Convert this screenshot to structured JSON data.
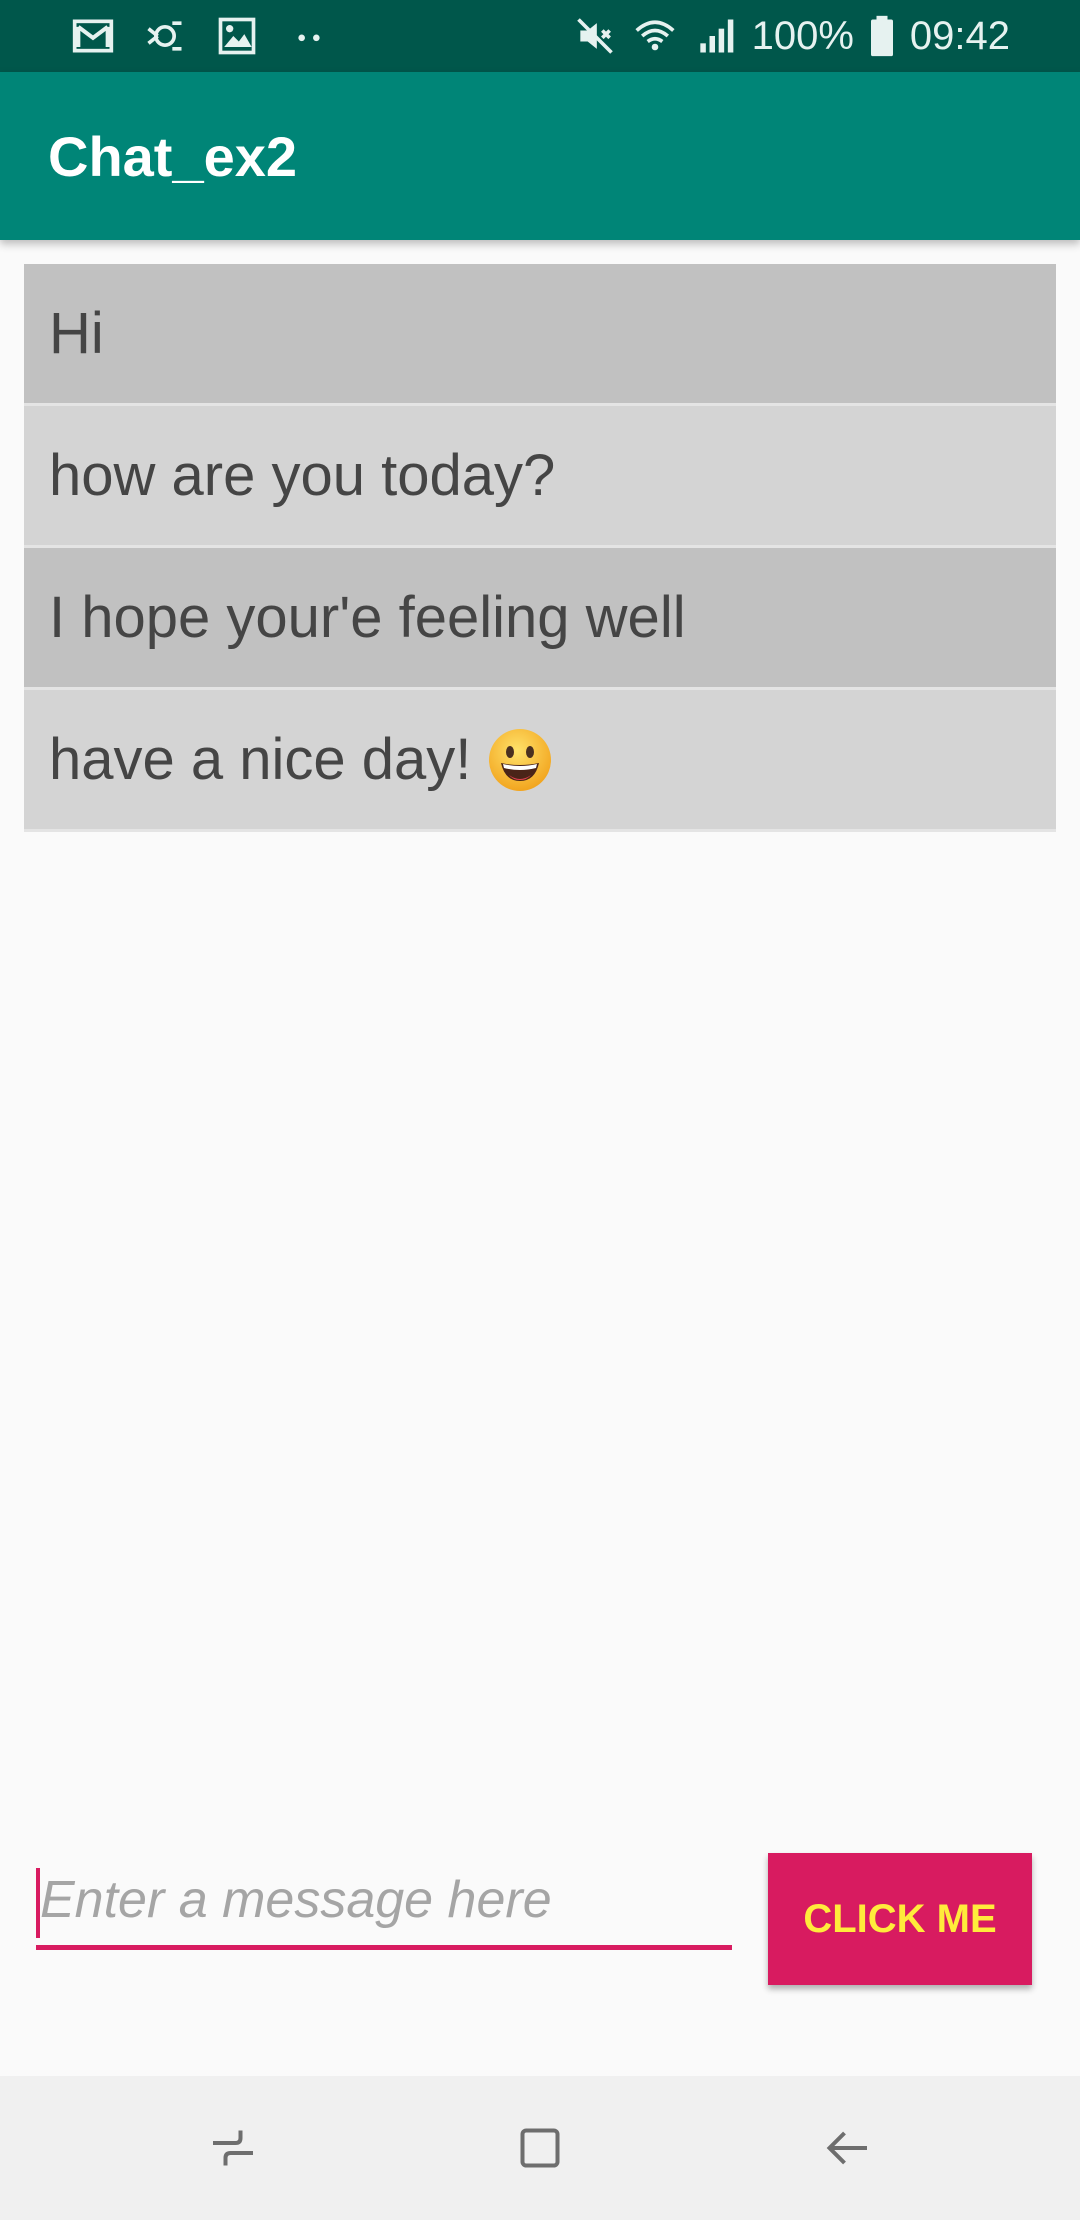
{
  "status_bar": {
    "left_icons": [
      "gmail-icon",
      "sync-icon",
      "image-icon",
      "more-dots-icon"
    ],
    "right_icons": [
      "mute-icon",
      "wifi-icon",
      "signal-icon",
      "battery-icon"
    ],
    "battery": "100%",
    "time": "09:42"
  },
  "app_bar": {
    "title": "Chat_ex2"
  },
  "messages": [
    {
      "text": "Hi",
      "shade": "dark",
      "emoji": false
    },
    {
      "text": "how are you today?",
      "shade": "light",
      "emoji": false
    },
    {
      "text": "I hope your'e feeling well",
      "shade": "dark",
      "emoji": false
    },
    {
      "text": "have a nice day!",
      "shade": "light",
      "emoji": true
    }
  ],
  "composer": {
    "placeholder": "Enter a message here",
    "value": "",
    "button_label": "CLICK ME"
  },
  "nav_bar": {
    "buttons": [
      "recents-icon",
      "home-icon",
      "back-icon"
    ]
  },
  "colors": {
    "status_bar": "#00574b",
    "primary": "#008577",
    "accent": "#d81b60",
    "button_text": "#ffeb3b"
  }
}
